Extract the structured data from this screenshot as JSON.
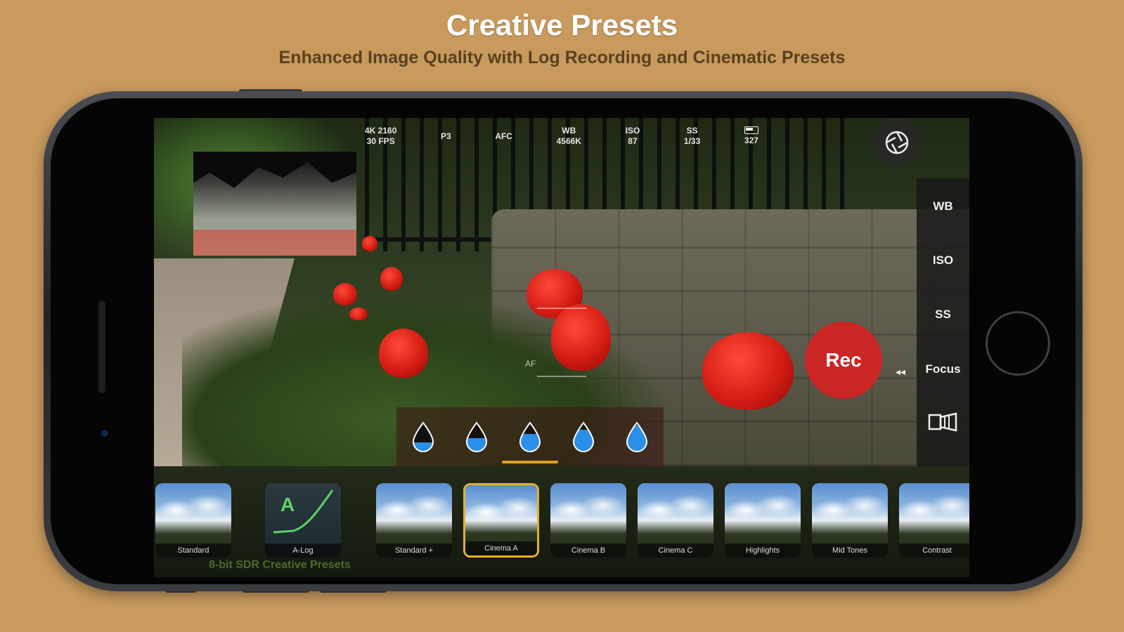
{
  "header": {
    "title": "Creative Presets",
    "subtitle": "Enhanced Image Quality with Log Recording and Cinematic Presets"
  },
  "status": {
    "resolution": "4K 2160",
    "fps": "30 FPS",
    "color_space": "P3",
    "focus_mode": "AFC",
    "wb_label": "WB",
    "wb_value": "4566K",
    "iso_label": "ISO",
    "iso_value": "87",
    "ss_label": "SS",
    "ss_value": "1/33",
    "storage": "327"
  },
  "side_panel": {
    "wb": "WB",
    "iso": "ISO",
    "ss": "SS",
    "focus": "Focus",
    "focus_arrow": "◂◂"
  },
  "rec_button": "Rec",
  "reticle_label": "AF",
  "drops": [
    {
      "fill": 0.35
    },
    {
      "fill": 0.5
    },
    {
      "fill": 0.65,
      "selected": true
    },
    {
      "fill": 0.8
    },
    {
      "fill": 0.95
    }
  ],
  "presets": [
    {
      "label": "Standard"
    },
    {
      "label": "A-Log"
    },
    {
      "label": "Standard +"
    },
    {
      "label": "Cinema A",
      "selected": true
    },
    {
      "label": "Cinema B"
    },
    {
      "label": "Cinema C"
    },
    {
      "label": "Highlights"
    },
    {
      "label": "Mid Tones"
    },
    {
      "label": "Contrast"
    }
  ],
  "strip_caption": "8-bit SDR Creative Presets",
  "colors": {
    "background": "#c89a5e",
    "rec": "#c92624",
    "selected": "#e6b02a",
    "drop": "#2a8fe8"
  }
}
